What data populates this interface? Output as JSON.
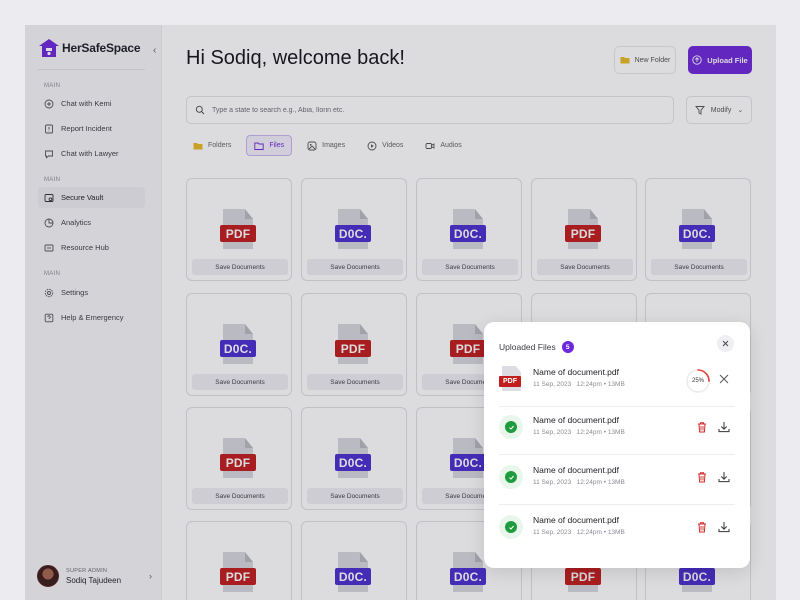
{
  "brand": {
    "name": "HerSafeSpace",
    "accent": "#6d28d9"
  },
  "sidebar": {
    "sections": [
      {
        "label": "MAIN",
        "items": [
          "Chat with Kemi",
          "Report Incident",
          "Chat with Lawyer"
        ]
      },
      {
        "label": "MAIN",
        "items": [
          "Secure Vault",
          "Analytics",
          "Resource Hub"
        ]
      },
      {
        "label": "MAIN",
        "items": [
          "Settings",
          "Help & Emergency"
        ]
      }
    ],
    "active_item": "Secure Vault",
    "user": {
      "role": "SUPER ADMIN",
      "name": "Sodiq Tajudeen"
    }
  },
  "header": {
    "greeting": "Hi Sodiq, welcome back!",
    "new_folder_label": "New Folder",
    "upload_label": "Upload File"
  },
  "search": {
    "placeholder": "Type a state to search e.g., Abia, Ilorin etc.",
    "value": ""
  },
  "modify_label": "Modify",
  "tabs": [
    {
      "label": "Folders",
      "icon": "folder-icon"
    },
    {
      "label": "Files",
      "icon": "file-icon",
      "active": true
    },
    {
      "label": "Images",
      "icon": "image-icon"
    },
    {
      "label": "Videos",
      "icon": "video-icon"
    },
    {
      "label": "Audios",
      "icon": "audio-icon"
    }
  ],
  "grid": {
    "card_label": "Save Documents",
    "rows": [
      [
        "PDF",
        "D0C.",
        "D0C.",
        "PDF",
        "D0C."
      ],
      [
        "D0C.",
        "PDF",
        "PDF",
        "",
        ""
      ],
      [
        "PDF",
        "D0C.",
        "D0C.",
        "",
        ""
      ],
      [
        "PDF",
        "D0C.",
        "D0C.",
        "PDF",
        "D0C."
      ]
    ]
  },
  "upload_panel": {
    "title": "Uploaded Files",
    "count": "5",
    "files": [
      {
        "name": "Name of document.pdf",
        "date": "11 Sep, 2023",
        "time": "12:24pm",
        "size": "13MB",
        "status": "uploading",
        "progress": 25,
        "progress_text": "25%"
      },
      {
        "name": "Name of document.pdf",
        "date": "11 Sep, 2023",
        "time": "12:24pm",
        "size": "13MB",
        "status": "done"
      },
      {
        "name": "Name of document.pdf",
        "date": "11 Sep, 2023",
        "time": "12:24pm",
        "size": "13MB",
        "status": "done"
      },
      {
        "name": "Name of document.pdf",
        "date": "11 Sep, 2023",
        "time": "12:24pm",
        "size": "13MB",
        "status": "done"
      }
    ]
  },
  "colors": {
    "pdf": "#c21d1d",
    "doc": "#4a2ed0",
    "success": "#1e9b3c",
    "progress": "#e2423a"
  }
}
